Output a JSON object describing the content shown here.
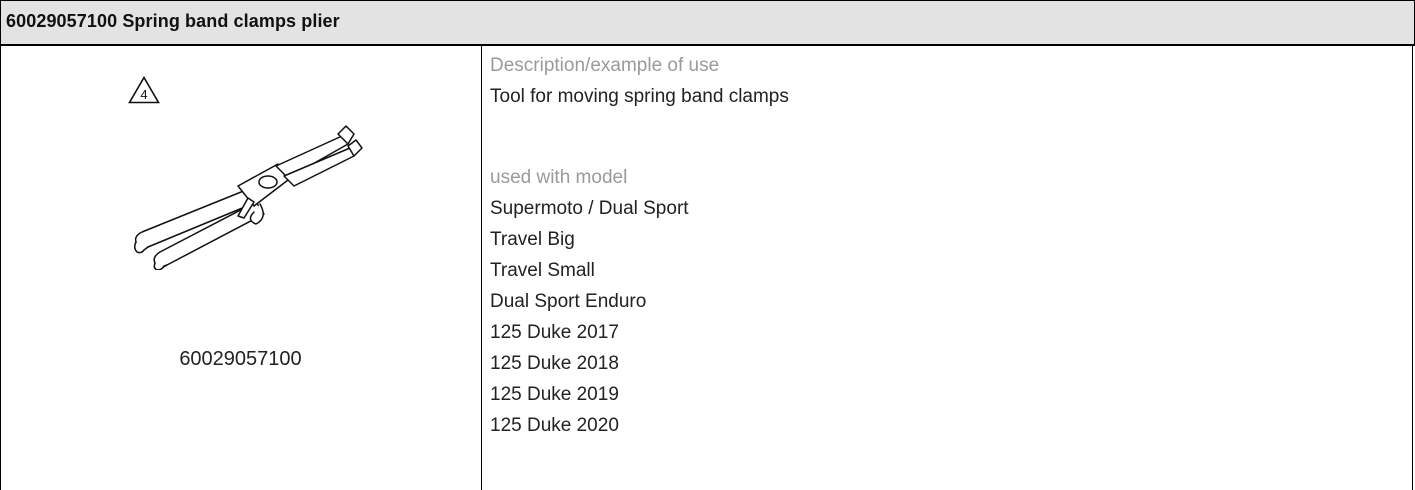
{
  "header": {
    "title": "60029057100 Spring band clamps plier"
  },
  "illustration": {
    "warning_badge": "4",
    "icon": "spring-band-clamp-plier-illustration",
    "caption": "60029057100"
  },
  "details": {
    "description_label": "Description/example of use",
    "description_text": "Tool for moving spring band clamps",
    "models_label": "used with model",
    "models": [
      "Supermoto / Dual Sport",
      "Travel Big",
      "Travel Small",
      "Dual Sport Enduro",
      "125 Duke 2017",
      "125 Duke 2018",
      "125 Duke 2019",
      "125 Duke 2020"
    ]
  }
}
